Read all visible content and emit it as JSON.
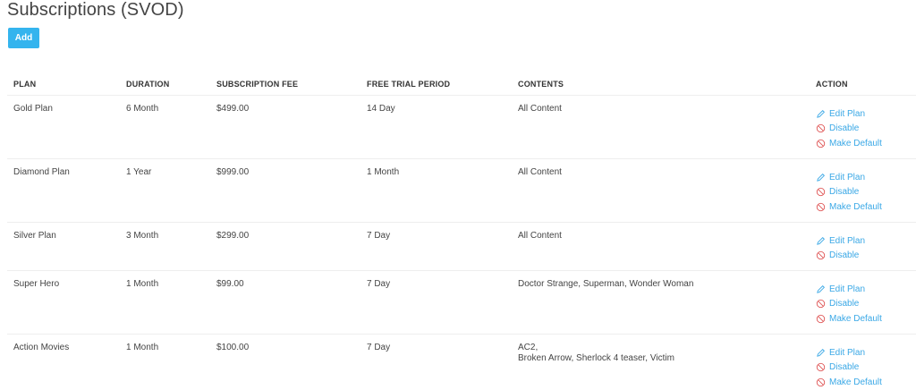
{
  "page": {
    "title": "Subscriptions (SVOD)",
    "add_label": "Add"
  },
  "colors": {
    "accent": "#34b4ee",
    "link": "#3aa8e6",
    "disable_icon": "#e05a5a"
  },
  "table": {
    "headers": {
      "plan": "PLAN",
      "duration": "DURATION",
      "fee": "SUBSCRIPTION FEE",
      "trial": "FREE TRIAL PERIOD",
      "contents": "CONTENTS",
      "action": "ACTION"
    },
    "rows": [
      {
        "plan": "Gold Plan",
        "duration": "6 Month",
        "fee": "$499.00",
        "trial": "14 Day",
        "contents_line1": "All Content",
        "contents_line2": "",
        "actions": {
          "edit": "Edit Plan",
          "disable": "Disable",
          "make_default": "Make Default"
        }
      },
      {
        "plan": "Diamond Plan",
        "duration": "1 Year",
        "fee": "$999.00",
        "trial": "1 Month",
        "contents_line1": "All Content",
        "contents_line2": "",
        "actions": {
          "edit": "Edit Plan",
          "disable": "Disable",
          "make_default": "Make Default"
        }
      },
      {
        "plan": "Silver Plan",
        "duration": "3 Month",
        "fee": "$299.00",
        "trial": "7 Day",
        "contents_line1": "All Content",
        "contents_line2": "",
        "actions": {
          "edit": "Edit Plan",
          "disable": "Disable"
        }
      },
      {
        "plan": "Super Hero",
        "duration": "1 Month",
        "fee": "$99.00",
        "trial": "7 Day",
        "contents_line1": "Doctor Strange, Superman, Wonder Woman",
        "contents_line2": "",
        "actions": {
          "edit": "Edit Plan",
          "disable": "Disable",
          "make_default": "Make Default"
        }
      },
      {
        "plan": "Action Movies",
        "duration": "1 Month",
        "fee": "$100.00",
        "trial": "7 Day",
        "contents_line1": "AC2,",
        "contents_line2": "Broken Arrow, Sherlock 4 teaser, Victim",
        "actions": {
          "edit": "Edit Plan",
          "disable": "Disable",
          "make_default": "Make Default"
        }
      }
    ]
  }
}
